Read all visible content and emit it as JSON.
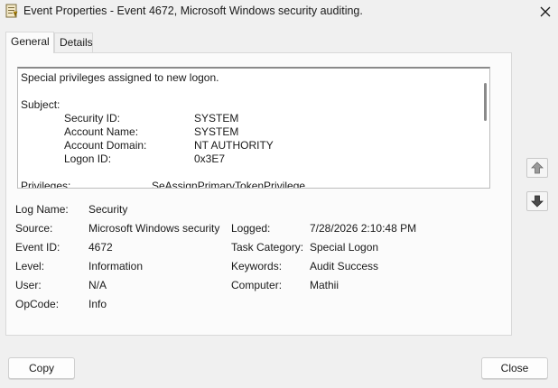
{
  "window": {
    "title": "Event Properties - Event 4672, Microsoft Windows security auditing."
  },
  "tabs": [
    {
      "label": "General",
      "selected": true
    },
    {
      "label": "Details",
      "selected": false
    }
  ],
  "description": {
    "heading": "Special privileges assigned to new logon.",
    "subject_label": "Subject:",
    "subject": [
      {
        "key": "Security ID:",
        "value": "SYSTEM"
      },
      {
        "key": "Account Name:",
        "value": "SYSTEM"
      },
      {
        "key": "Account Domain:",
        "value": "NT AUTHORITY"
      },
      {
        "key": "Logon ID:",
        "value": "0x3E7"
      }
    ],
    "privileges_label": "Privileges:",
    "privileges_value": "SeAssignPrimaryTokenPrivilege"
  },
  "fields": {
    "log_name": {
      "label": "Log Name:",
      "value": "Security"
    },
    "source": {
      "label": "Source:",
      "value": "Microsoft Windows security"
    },
    "logged": {
      "label": "Logged:",
      "value": "7/28/2026 2:10:48 PM"
    },
    "event_id": {
      "label": "Event ID:",
      "value": "4672"
    },
    "task_category": {
      "label": "Task Category:",
      "value": "Special Logon"
    },
    "level": {
      "label": "Level:",
      "value": "Information"
    },
    "keywords": {
      "label": "Keywords:",
      "value": "Audit Success"
    },
    "user": {
      "label": "User:",
      "value": "N/A"
    },
    "computer": {
      "label": "Computer:",
      "value": "Mathii"
    },
    "opcode": {
      "label": "OpCode:",
      "value": "Info"
    }
  },
  "buttons": {
    "copy": "Copy",
    "close": "Close"
  },
  "icons": {
    "app": "event-viewer-icon",
    "close": "close-icon",
    "prev": "arrow-up-icon",
    "next": "arrow-down-icon"
  },
  "colors": {
    "background": "#f0f0f0",
    "panel": "#fbfbfb",
    "text": "#1a1a1a",
    "arrow": "#4a4a4a"
  }
}
